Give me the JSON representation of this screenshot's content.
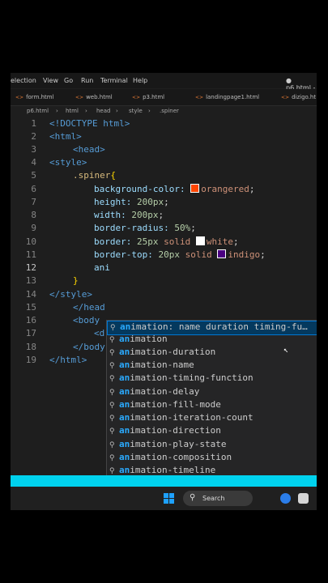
{
  "menu": [
    "election",
    "View",
    "Go",
    "Run",
    "Terminal",
    "Help"
  ],
  "window_title": "● p6.html -",
  "tabs": [
    "form.html",
    "web.html",
    "p3.html",
    "landingpage1.html",
    "dizigo.ht"
  ],
  "breadcrumb": [
    "p6.html",
    "html",
    "head",
    "style",
    ".spiner"
  ],
  "line_numbers": [
    "1",
    "2",
    "3",
    "4",
    "5",
    "6",
    "7",
    "8",
    "9",
    "10",
    "11",
    "12",
    "13",
    "14",
    "15",
    "16",
    "17",
    "18",
    "19"
  ],
  "code": {
    "l1": "<!DOCTYPE html>",
    "l2": "<html>",
    "l3": "<head>",
    "l4": "<style>",
    "l5_sel": ".spiner",
    "l5_brace": "{",
    "l6_prop": "background-color:",
    "l6_val": "orangered",
    "l7_prop": "height:",
    "l7_val": "200px",
    "l8_prop": "width:",
    "l8_val": "200px",
    "l9_prop": "border-radius:",
    "l9_val": "50%",
    "l10_prop": "border:",
    "l10_num": "25px",
    "l10_rest": "solid",
    "l10_color": "white",
    "l11_prop": "border-top:",
    "l11_num": "20px",
    "l11_rest": "solid",
    "l11_color": "indigo",
    "l12": "ani",
    "l13": "}",
    "l14": "</style>",
    "l15": "</head",
    "l16_a": "<body",
    "l17_a": "<d",
    "l18_a": "</body",
    "l19": "</html>",
    "semi": ";"
  },
  "colors": {
    "orangered": "#ff4500",
    "white": "#ffffff",
    "indigo": "#4b0082",
    "accent": "#00d2ee"
  },
  "suggestions": [
    {
      "match": "an",
      "rest": "imation: name duration timing-fu…"
    },
    {
      "match": "an",
      "rest": "imation"
    },
    {
      "match": "an",
      "rest": "imation-duration"
    },
    {
      "match": "an",
      "rest": "imation-name"
    },
    {
      "match": "an",
      "rest": "imation-timing-function"
    },
    {
      "match": "an",
      "rest": "imation-delay"
    },
    {
      "match": "an",
      "rest": "imation-fill-mode"
    },
    {
      "match": "an",
      "rest": "imation-iteration-count"
    },
    {
      "match": "an",
      "rest": "imation-direction"
    },
    {
      "match": "an",
      "rest": "imation-play-state"
    },
    {
      "match": "an",
      "rest": "imation-composition"
    },
    {
      "match": "an",
      "rest": "imation-timeline"
    }
  ],
  "taskbar": {
    "search_label": "Search"
  }
}
